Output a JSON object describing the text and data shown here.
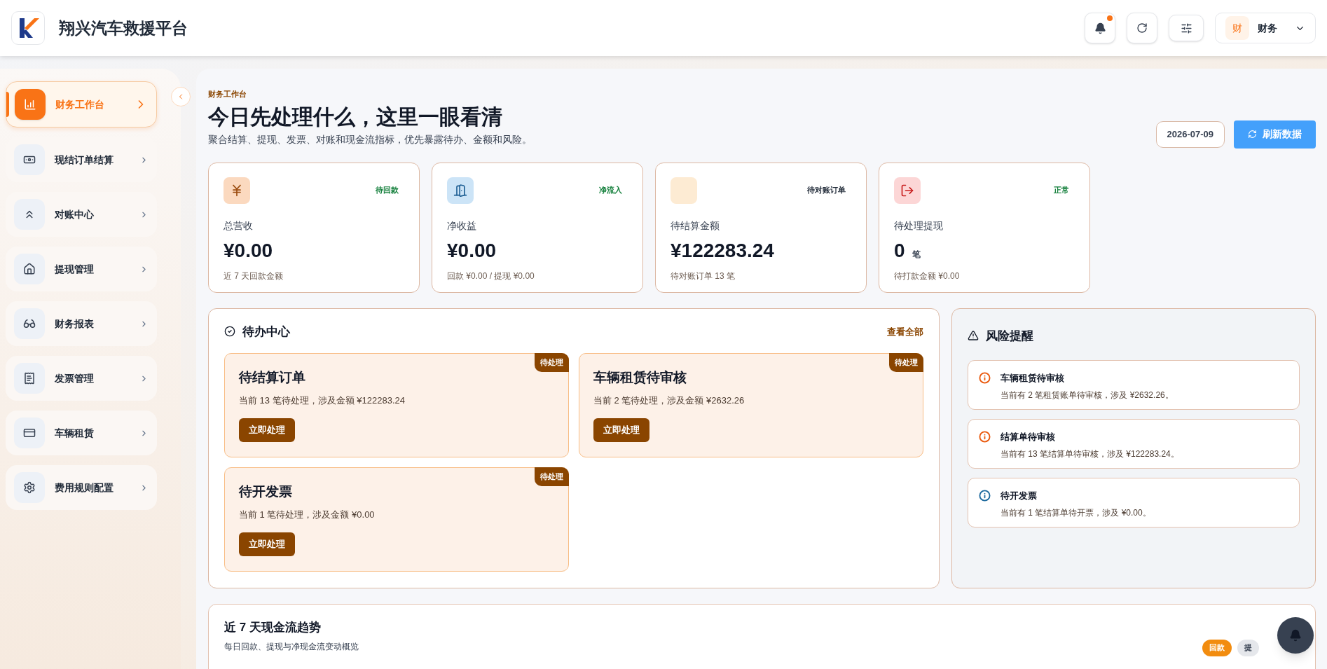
{
  "header": {
    "title": "翔兴汽车救援平台",
    "notifications_unread": true,
    "user": {
      "avatar_text": "财",
      "name": "财务"
    }
  },
  "sidebar": {
    "items": [
      {
        "label": "财务工作台",
        "selected": true
      },
      {
        "label": "现结订单结算",
        "selected": false
      },
      {
        "label": "对账中心",
        "selected": false
      },
      {
        "label": "提现管理",
        "selected": false
      },
      {
        "label": "财务报表",
        "selected": false
      },
      {
        "label": "发票管理",
        "selected": false
      },
      {
        "label": "车辆租赁",
        "selected": false
      },
      {
        "label": "费用规则配置",
        "selected": false
      }
    ]
  },
  "page": {
    "eyebrow": "财务工作台",
    "title": "今日先处理什么，这里一眼看清",
    "subtitle": "聚合结算、提现、发票、对账和现金流指标，优先暴露待办、金额和风险。",
    "date": "2026-07-09",
    "refresh": "刷新数据"
  },
  "stats": [
    {
      "label": "总营收",
      "value": "¥0.00",
      "note": "近 7 天回款金额",
      "badge": "待回款",
      "color": "#15803d"
    },
    {
      "label": "净收益",
      "value": "¥0.00",
      "note": "回款 ¥0.00 / 提现 ¥0.00",
      "badge": "净流入",
      "color": "#15803d"
    },
    {
      "label": "待结算金额",
      "value": "¥122283.24",
      "note": "待对账订单 13 笔",
      "badge": "待对账订单",
      "color": "#1f2937"
    },
    {
      "label": "待处理提现",
      "value": "0",
      "unit": "笔",
      "note": "待打款金额 ¥0.00",
      "badge": "正常",
      "color": "#15803d"
    }
  ],
  "todo": {
    "title": "待办中心",
    "link": "查看全部",
    "items": [
      {
        "title": "待结算订单",
        "desc": "当前 13 笔待处理，涉及金额 ¥122283.24",
        "badge": "待处理",
        "action": "立即处理"
      },
      {
        "title": "车辆租赁待审核",
        "desc": "当前 2 笔待处理，涉及金额 ¥2632.26",
        "badge": "待处理",
        "action": "立即处理"
      },
      {
        "title": "待开发票",
        "desc": "当前 1 笔待处理，涉及金额 ¥0.00",
        "badge": "待处理",
        "action": "立即处理"
      }
    ]
  },
  "risk": {
    "title": "风险提醒",
    "items": [
      {
        "title": "车辆租赁待审核",
        "desc": "当前有 2 笔租赁账单待审核，涉及 ¥2632.26。",
        "color": "#ea580c"
      },
      {
        "title": "结算单待审核",
        "desc": "当前有 13 笔结算单待审核，涉及 ¥122283.24。",
        "color": "#ea580c"
      },
      {
        "title": "待开发票",
        "desc": "当前有 1 笔结算单待开票，涉及 ¥0.00。",
        "color": "#1e6a9e"
      }
    ]
  },
  "trend": {
    "title": "近 7 天现金流趋势",
    "subtitle": "每日回款、提现与净现金流变动概览",
    "legend": [
      {
        "label": "回款",
        "color": "#f28c0f"
      },
      {
        "label": "提",
        "color": "#e5e7eb"
      }
    ]
  }
}
